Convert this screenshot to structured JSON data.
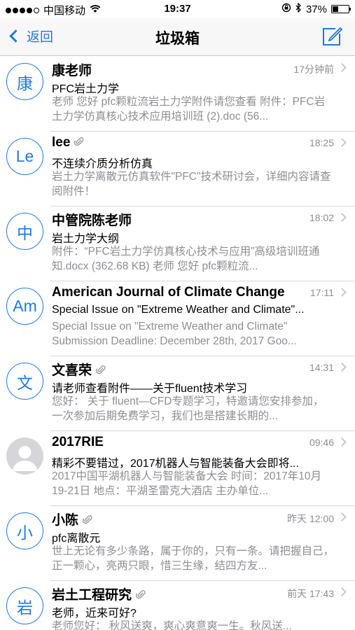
{
  "status_bar": {
    "carrier": "中国移动",
    "time": "19:37",
    "battery": "37%",
    "battery_level": 0.37
  },
  "nav": {
    "back_label": "返回",
    "title": "垃圾箱"
  },
  "mails": [
    {
      "avatar": "康",
      "sender": "康老师",
      "attachment": false,
      "time": "17分钟前",
      "subject": "PFC岩土力学",
      "preview": "老师 您好 pfc颗粒流岩土力学附件请您查看 附件：PFC岩土力学仿真核心技术应用培训班 (2).doc (56..."
    },
    {
      "avatar": "Le",
      "sender": "lee",
      "attachment": true,
      "time": "18:25",
      "subject": "不连续介质分析仿真",
      "preview": "岩土力学离散元仿真软件\"PFC\"技术研讨会，详细内容请查阅附件！"
    },
    {
      "avatar": "中",
      "sender": "中管院陈老师",
      "attachment": false,
      "time": "18:02",
      "subject": "岩土力学大纲",
      "preview": "附件：“PFC岩土力学仿真核心技术与应用”高级培训班通知.docx (362.68 KB) 老师 您好 pfc颗粒流..."
    },
    {
      "avatar": "Am",
      "sender": "American Journal of Climate Change",
      "attachment": false,
      "time": "17:11",
      "subject": "Special Issue on \"Extreme Weather and Climate\"...",
      "preview": "Special Issue on \"Extreme Weather and Climate\" Submission Deadline: December 28th, 2017 Goo..."
    },
    {
      "avatar": "文",
      "sender": "文喜荣",
      "attachment": true,
      "time": "14:31",
      "subject": "请老师查看附件——关于fluent技术学习",
      "preview": "您好： 关于 fluent—CFD专题学习，特邀请您安排参加，一次参加后期免费学习，我们也是搭建长期的..."
    },
    {
      "avatar": "",
      "sender": "2017RIE",
      "attachment": false,
      "time": "09:46",
      "subject": "精彩不要错过，2017机器人与智能装备大会即将...",
      "preview": "2017中国平湖机器人与智能装备大会 时间：2017年10月19-21日 地点：平湖圣雷克大酒店 主办单位..."
    },
    {
      "avatar": "小",
      "sender": "小陈",
      "attachment": true,
      "time": "昨天 12:00",
      "subject": "pfc离散元",
      "preview": "世上无论有多少条路，属于你的，只有一条。请把握自己，正一颗心，亮两只眼，惜三生缘，结四方友..."
    },
    {
      "avatar": "岩",
      "sender": "岩土工程研究",
      "attachment": true,
      "time": "前天 17:43",
      "subject": "老师，近来可好?",
      "preview": "老师您好： 秋风送爽，爽心爽意爽一生。秋风送..."
    }
  ],
  "colors": {
    "accent": "#1f7ae0",
    "secondary_text": "#8e8e93",
    "separator": "#d8d8dc"
  }
}
